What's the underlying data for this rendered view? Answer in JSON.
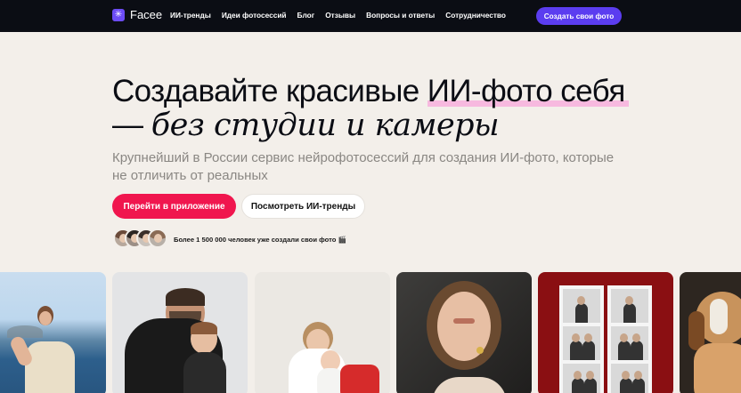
{
  "nav": {
    "logo_text": "Facee",
    "links": [
      "ИИ-тренды",
      "Идеи фотосессий",
      "Блог",
      "Отзывы",
      "Вопросы и ответы",
      "Сотрудничество"
    ],
    "cta": "Создать свои фото"
  },
  "hero": {
    "title_part1": "Создавайте красивые ",
    "title_highlight": "ИИ-фото себя",
    "title_dash": "— ",
    "title_line2": "без студии и камеры",
    "subtitle": "Крупнейший в России сервис нейрофотосессий для создания ИИ-фото, которые не отличить от реальных",
    "primary_button": "Перейти в приложение",
    "secondary_button": "Посмотреть ИИ-тренды",
    "social_proof": "Более 1 500 000 человек уже создали свои фото 🎬"
  },
  "colors": {
    "nav_bg": "#0b0d14",
    "brand_purple": "#5b3df0",
    "primary_pink": "#f0164e",
    "highlight": "#f7b9df",
    "page_bg": "#f3efea"
  },
  "icons": {
    "logo": "sparkle-logo-icon"
  }
}
